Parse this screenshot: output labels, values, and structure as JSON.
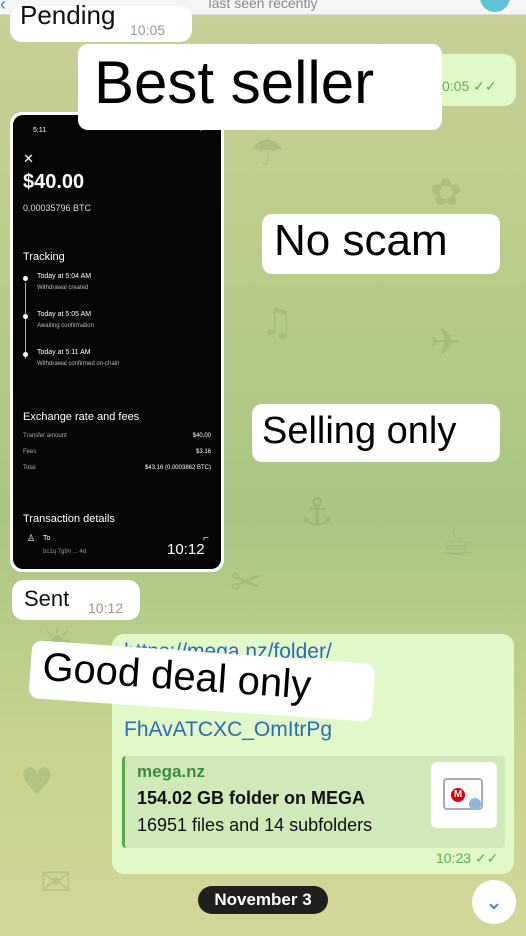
{
  "header": {
    "status": "last seen recently"
  },
  "messages": {
    "pending": {
      "text": "Pending",
      "time": "10:05"
    },
    "out1": {
      "time": "0:05"
    },
    "screenshot": {
      "status_time": "5:11",
      "amount": "$40.00",
      "btc": "0.00035796 BTC",
      "tracking_title": "Tracking",
      "steps": [
        {
          "time": "Today at 5:04 AM",
          "desc": "Withdrawal created"
        },
        {
          "time": "Today at 5:05 AM",
          "desc": "Awaiting confirmation"
        },
        {
          "time": "Today at 5:11 AM",
          "desc": "Withdrawal confirmed on-chain"
        }
      ],
      "fees_title": "Exchange rate and fees",
      "fees": [
        {
          "label": "Transfer amount",
          "value": "$40.00"
        },
        {
          "label": "Fees",
          "value": "$3.16"
        },
        {
          "label": "Total",
          "value": "$43.16 (0.0003862 BTC)"
        }
      ],
      "details_title": "Transaction details",
      "to_label": "To",
      "address": "bc1q 7g9n ... 4d",
      "time": "10:12"
    },
    "sent": {
      "text": "Sent",
      "time": "10:12"
    },
    "link": {
      "url_line1": "https://mega.nz/folder/",
      "url_line3": "FhAvATCXC_OmItrPg",
      "preview": {
        "site": "mega.nz",
        "title": "154.02 GB folder on MEGA",
        "subtitle": "16951 files and 14 subfolders"
      },
      "time": "10:23"
    }
  },
  "date_pill": "November 3",
  "stickers": {
    "s1": "Best seller",
    "s2": "No scam",
    "s3": "Selling only",
    "s4": "Good deal only"
  },
  "icons": {
    "back": "back-icon",
    "double_check": "double-check-icon",
    "scroll_down": "chevron-down-icon",
    "mega": "mega-logo-icon"
  }
}
